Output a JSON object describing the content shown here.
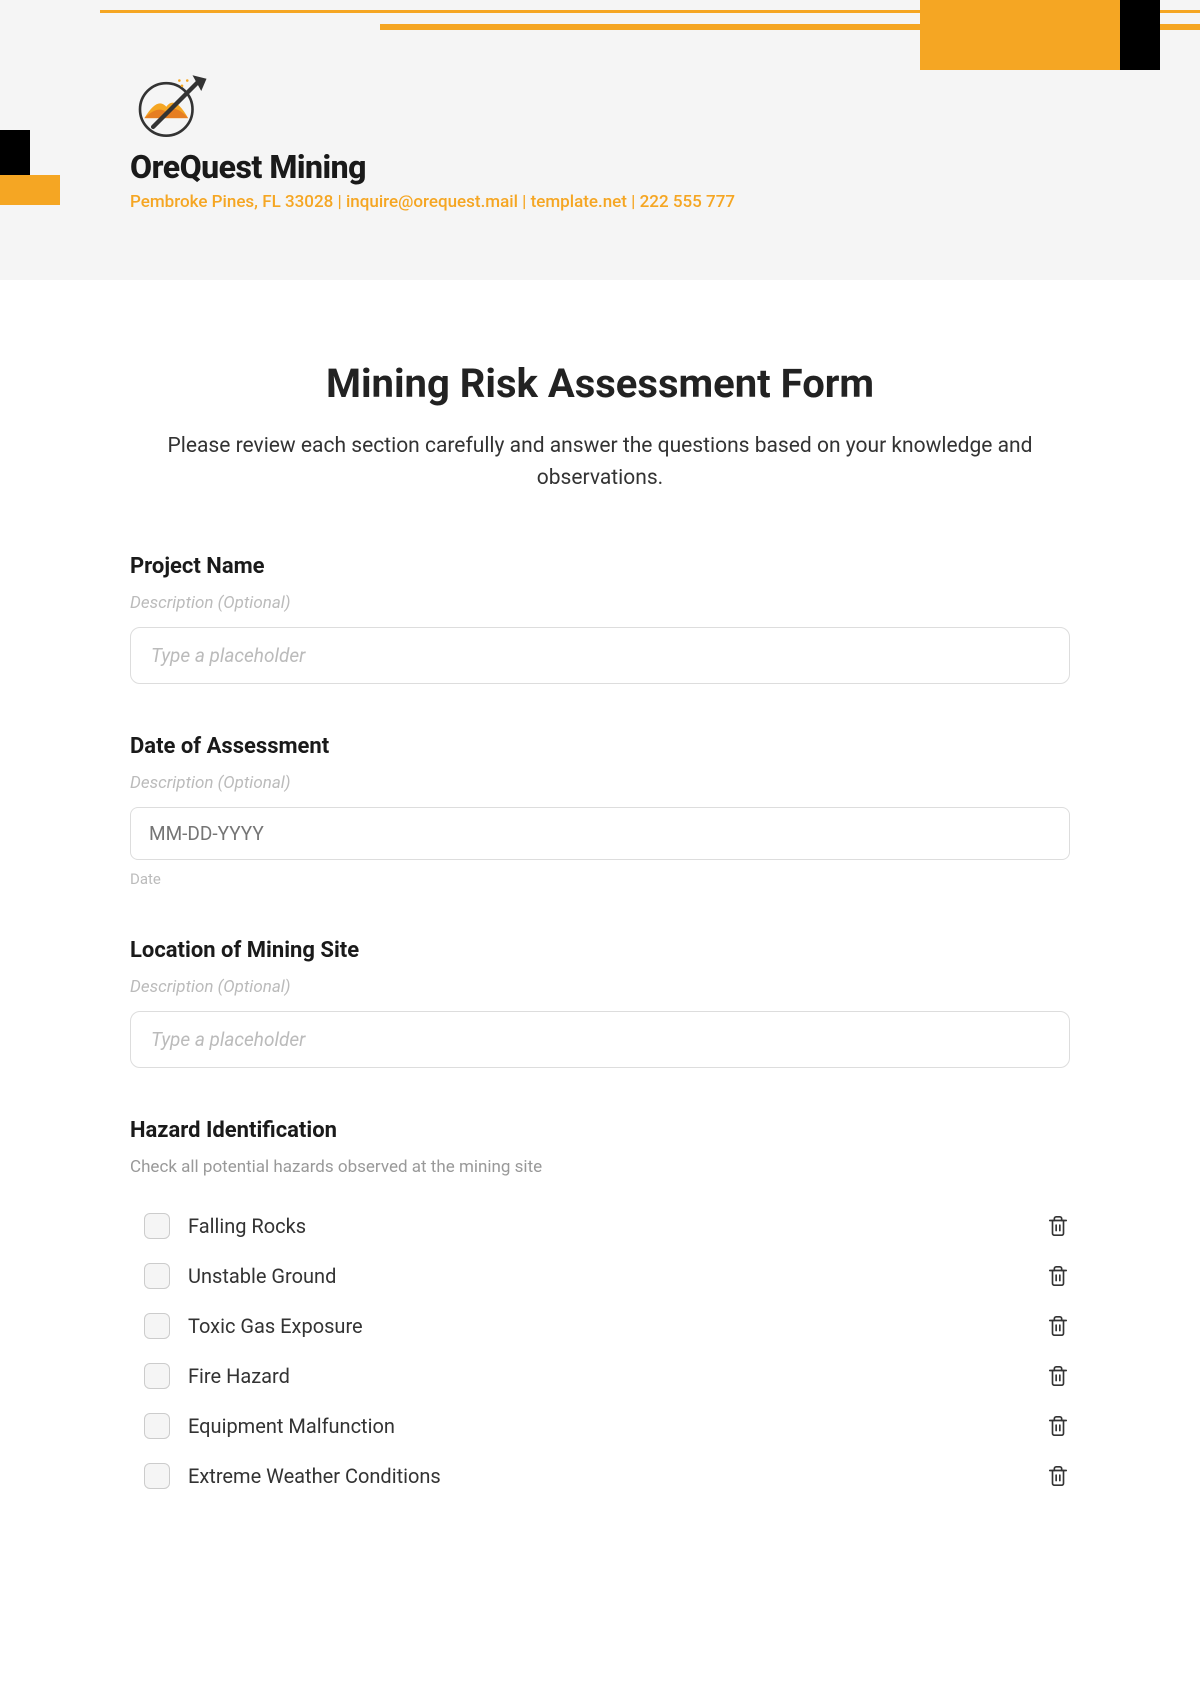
{
  "header": {
    "company_name": "OreQuest Mining",
    "contact_line": "Pembroke Pines, FL 33028 | inquire@orequest.mail | template.net | 222 555 777"
  },
  "form": {
    "title": "Mining Risk Assessment Form",
    "subtitle": "Please review each section carefully and answer the questions based on your knowledge and observations.",
    "fields": {
      "project_name": {
        "label": "Project Name",
        "desc": "Description (Optional)",
        "placeholder": "Type a placeholder"
      },
      "assessment_date": {
        "label": "Date of Assessment",
        "desc": "Description (Optional)",
        "placeholder": "MM-DD-YYYY",
        "sublabel": "Date"
      },
      "location": {
        "label": "Location of Mining Site",
        "desc": "Description (Optional)",
        "placeholder": "Type a placeholder"
      },
      "hazards": {
        "label": "Hazard Identification",
        "desc": "Check all potential hazards observed at the mining site",
        "items": [
          "Falling Rocks",
          "Unstable Ground",
          "Toxic Gas Exposure",
          "Fire Hazard",
          "Equipment Malfunction",
          "Extreme Weather Conditions"
        ]
      }
    }
  }
}
